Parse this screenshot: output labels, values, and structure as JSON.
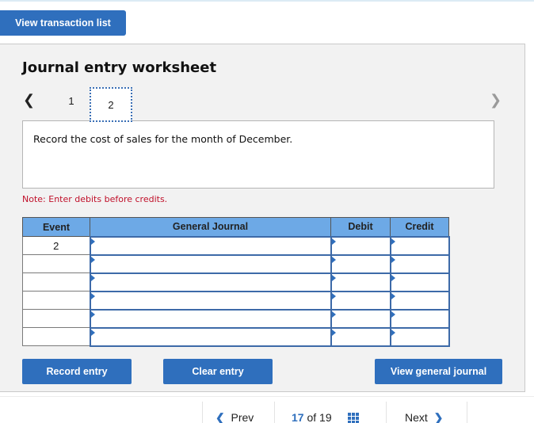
{
  "header": {
    "view_transaction_list": "View transaction list"
  },
  "worksheet": {
    "title": "Journal entry worksheet",
    "tabs": [
      {
        "label": "1"
      },
      {
        "label": "2",
        "active": true
      }
    ],
    "description": "Record the cost of sales for the month of December.",
    "note": "Note: Enter debits before credits."
  },
  "table": {
    "columns": [
      "Event",
      "General Journal",
      "Debit",
      "Credit"
    ],
    "rows": [
      {
        "event": "2",
        "account": "",
        "debit": "",
        "credit": ""
      },
      {
        "event": "",
        "account": "",
        "debit": "",
        "credit": ""
      },
      {
        "event": "",
        "account": "",
        "debit": "",
        "credit": ""
      },
      {
        "event": "",
        "account": "",
        "debit": "",
        "credit": ""
      },
      {
        "event": "",
        "account": "",
        "debit": "",
        "credit": ""
      },
      {
        "event": "",
        "account": "",
        "debit": "",
        "credit": ""
      }
    ]
  },
  "actions": {
    "record_entry": "Record entry",
    "clear_entry": "Clear entry",
    "view_general_journal": "View general journal"
  },
  "pager": {
    "prev_label": "Prev",
    "next_label": "Next",
    "current": "17",
    "of_label": "of",
    "total": "19"
  },
  "icons": {
    "prev_arrow": "‹",
    "next_arrow": "›",
    "grid": "grid-icon"
  },
  "colors": {
    "accent": "#2f6fbd",
    "header_bg": "#6da9e6",
    "note": "#c0102a",
    "panel_bg": "#f2f2f2"
  }
}
